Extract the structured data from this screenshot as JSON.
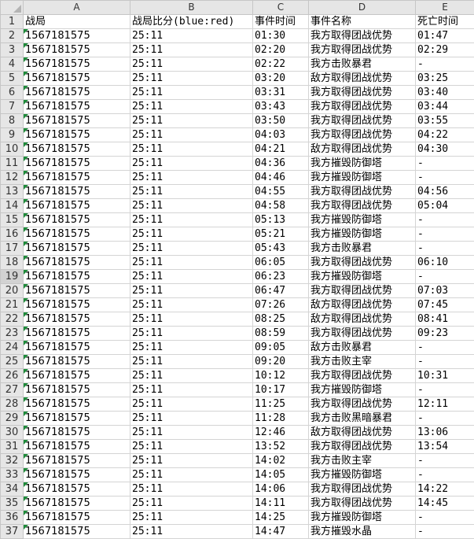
{
  "columns": [
    "A",
    "B",
    "C",
    "D",
    "E"
  ],
  "header_row": {
    "row": "1",
    "cells": [
      "战局",
      "战局比分(blue:red)",
      "事件时间",
      "事件名称",
      "死亡时间"
    ]
  },
  "rows": [
    {
      "row": "2",
      "cells": [
        "1567181575",
        "25:11",
        "01:30",
        "我方取得团战优势",
        "01:47"
      ]
    },
    {
      "row": "3",
      "cells": [
        "1567181575",
        "25:11",
        "02:20",
        "我方取得团战优势",
        "02:29"
      ]
    },
    {
      "row": "4",
      "cells": [
        "1567181575",
        "25:11",
        "02:22",
        "我方击败暴君",
        "-"
      ]
    },
    {
      "row": "5",
      "cells": [
        "1567181575",
        "25:11",
        "03:20",
        "敌方取得团战优势",
        "03:25"
      ]
    },
    {
      "row": "6",
      "cells": [
        "1567181575",
        "25:11",
        "03:31",
        "我方取得团战优势",
        "03:40"
      ]
    },
    {
      "row": "7",
      "cells": [
        "1567181575",
        "25:11",
        "03:43",
        "我方取得团战优势",
        "03:44"
      ]
    },
    {
      "row": "8",
      "cells": [
        "1567181575",
        "25:11",
        "03:50",
        "我方取得团战优势",
        "03:55"
      ]
    },
    {
      "row": "9",
      "cells": [
        "1567181575",
        "25:11",
        "04:03",
        "我方取得团战优势",
        "04:22"
      ]
    },
    {
      "row": "10",
      "cells": [
        "1567181575",
        "25:11",
        "04:21",
        "敌方取得团战优势",
        "04:30"
      ]
    },
    {
      "row": "11",
      "cells": [
        "1567181575",
        "25:11",
        "04:36",
        "我方摧毁防御塔",
        "-"
      ]
    },
    {
      "row": "12",
      "cells": [
        "1567181575",
        "25:11",
        "04:46",
        "我方摧毁防御塔",
        "-"
      ]
    },
    {
      "row": "13",
      "cells": [
        "1567181575",
        "25:11",
        "04:55",
        "我方取得团战优势",
        "04:56"
      ]
    },
    {
      "row": "14",
      "cells": [
        "1567181575",
        "25:11",
        "04:58",
        "我方取得团战优势",
        "05:04"
      ]
    },
    {
      "row": "15",
      "cells": [
        "1567181575",
        "25:11",
        "05:13",
        "我方摧毁防御塔",
        "-"
      ]
    },
    {
      "row": "16",
      "cells": [
        "1567181575",
        "25:11",
        "05:21",
        "我方摧毁防御塔",
        "-"
      ]
    },
    {
      "row": "17",
      "cells": [
        "1567181575",
        "25:11",
        "05:43",
        "我方击败暴君",
        "-"
      ]
    },
    {
      "row": "18",
      "cells": [
        "1567181575",
        "25:11",
        "06:05",
        "我方取得团战优势",
        "06:10"
      ]
    },
    {
      "row": "19",
      "cells": [
        "1567181575",
        "25:11",
        "06:23",
        "我方摧毁防御塔",
        "-"
      ]
    },
    {
      "row": "20",
      "cells": [
        "1567181575",
        "25:11",
        "06:47",
        "我方取得团战优势",
        "07:03"
      ]
    },
    {
      "row": "21",
      "cells": [
        "1567181575",
        "25:11",
        "07:26",
        "敌方取得团战优势",
        "07:45"
      ]
    },
    {
      "row": "22",
      "cells": [
        "1567181575",
        "25:11",
        "08:25",
        "敌方取得团战优势",
        "08:41"
      ]
    },
    {
      "row": "23",
      "cells": [
        "1567181575",
        "25:11",
        "08:59",
        "我方取得团战优势",
        "09:23"
      ]
    },
    {
      "row": "24",
      "cells": [
        "1567181575",
        "25:11",
        "09:05",
        "敌方击败暴君",
        "-"
      ]
    },
    {
      "row": "25",
      "cells": [
        "1567181575",
        "25:11",
        "09:20",
        "我方击败主宰",
        "-"
      ]
    },
    {
      "row": "26",
      "cells": [
        "1567181575",
        "25:11",
        "10:12",
        "我方取得团战优势",
        "10:31"
      ]
    },
    {
      "row": "27",
      "cells": [
        "1567181575",
        "25:11",
        "10:17",
        "我方摧毁防御塔",
        "-"
      ]
    },
    {
      "row": "28",
      "cells": [
        "1567181575",
        "25:11",
        "11:25",
        "我方取得团战优势",
        "12:11"
      ]
    },
    {
      "row": "29",
      "cells": [
        "1567181575",
        "25:11",
        "11:28",
        "我方击败黑暗暴君",
        "-"
      ]
    },
    {
      "row": "30",
      "cells": [
        "1567181575",
        "25:11",
        "12:46",
        "敌方取得团战优势",
        "13:06"
      ]
    },
    {
      "row": "31",
      "cells": [
        "1567181575",
        "25:11",
        "13:52",
        "我方取得团战优势",
        "13:54"
      ]
    },
    {
      "row": "32",
      "cells": [
        "1567181575",
        "25:11",
        "14:02",
        "我方击败主宰",
        "-"
      ]
    },
    {
      "row": "33",
      "cells": [
        "1567181575",
        "25:11",
        "14:05",
        "我方摧毁防御塔",
        "-"
      ]
    },
    {
      "row": "34",
      "cells": [
        "1567181575",
        "25:11",
        "14:06",
        "我方取得团战优势",
        "14:22"
      ]
    },
    {
      "row": "35",
      "cells": [
        "1567181575",
        "25:11",
        "14:11",
        "我方取得团战优势",
        "14:45"
      ]
    },
    {
      "row": "36",
      "cells": [
        "1567181575",
        "25:11",
        "14:25",
        "我方摧毁防御塔",
        "-"
      ]
    },
    {
      "row": "37",
      "cells": [
        "1567181575",
        "25:11",
        "14:47",
        "我方摧毁水晶",
        "-"
      ]
    }
  ],
  "selected_row_header": "19",
  "colors": {
    "gridline": "#d4d4d4",
    "header_bg": "#e6e6e6",
    "number_as_text_indicator": "#1e8b3a"
  },
  "icons": {
    "select_all": "select-all-triangle-icon",
    "number_as_text": "green-error-triangle-icon"
  }
}
